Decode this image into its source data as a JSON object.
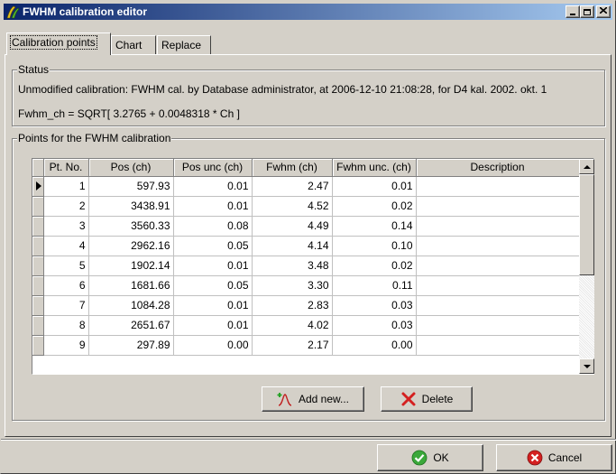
{
  "window": {
    "title": "FWHM calibration editor",
    "icon": "calibration-app-icon",
    "controls": {
      "minimize": "_",
      "maximize": "□",
      "close": "✕"
    }
  },
  "tabs": [
    {
      "label": "Calibration points",
      "active": true
    },
    {
      "label": "Chart",
      "active": false
    },
    {
      "label": "Replace",
      "active": false
    }
  ],
  "status": {
    "legend": "Status",
    "line1": "Unmodified calibration: FWHM cal. by Database administrator, at 2006-12-10 21:08:28, for D4 kal. 2002. okt. 1",
    "line2": "Fwhm_ch = SQRT[ 3.2765 + 0.0048318 * Ch ]"
  },
  "points": {
    "legend": "Points for the FWHM calibration",
    "columns": [
      "Pt. No.",
      "Pos (ch)",
      "Pos unc (ch)",
      "Fwhm (ch)",
      "Fwhm unc. (ch)",
      "Description"
    ],
    "rows": [
      [
        "1",
        "597.93",
        "0.01",
        "2.47",
        "0.01",
        ""
      ],
      [
        "2",
        "3438.91",
        "0.01",
        "4.52",
        "0.02",
        ""
      ],
      [
        "3",
        "3560.33",
        "0.08",
        "4.49",
        "0.14",
        ""
      ],
      [
        "4",
        "2962.16",
        "0.05",
        "4.14",
        "0.10",
        ""
      ],
      [
        "5",
        "1902.14",
        "0.01",
        "3.48",
        "0.02",
        ""
      ],
      [
        "6",
        "1681.66",
        "0.05",
        "3.30",
        "0.11",
        ""
      ],
      [
        "7",
        "1084.28",
        "0.01",
        "2.83",
        "0.03",
        ""
      ],
      [
        "8",
        "2651.67",
        "0.01",
        "4.02",
        "0.03",
        ""
      ],
      [
        "9",
        "297.89",
        "0.00",
        "2.17",
        "0.00",
        ""
      ]
    ],
    "add_label": "Add new...",
    "delete_label": "Delete"
  },
  "footer": {
    "ok_label": "OK",
    "cancel_label": "Cancel"
  },
  "colors": {
    "face": "#d4d0c8",
    "title_start": "#0a246a",
    "title_end": "#a6caf0",
    "ok_green": "#3aa83a",
    "cancel_red": "#d42020",
    "delete_red": "#d42020"
  }
}
